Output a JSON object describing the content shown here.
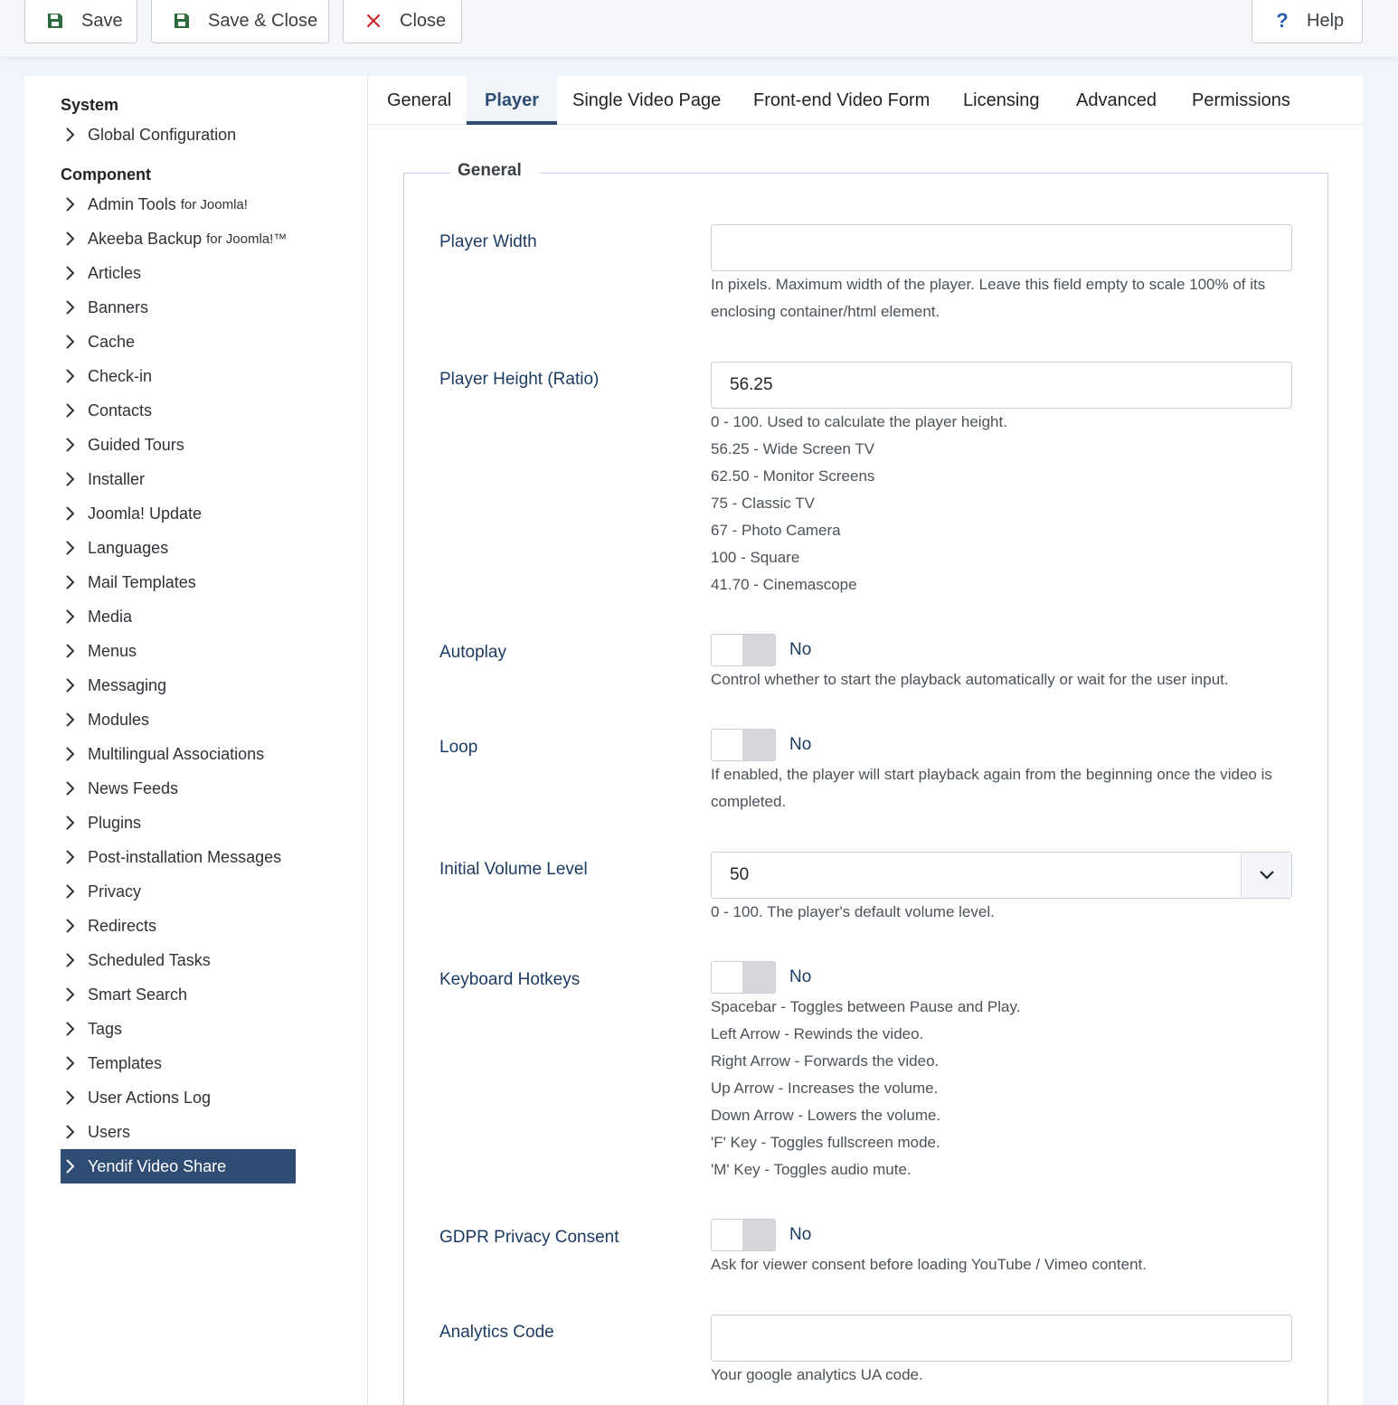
{
  "toolbar": {
    "save": "Save",
    "save_close": "Save & Close",
    "close": "Close",
    "help": "Help",
    "help_glyph": "?"
  },
  "sidebar": {
    "system_heading": "System",
    "system_items": [
      {
        "label": "Global Configuration"
      }
    ],
    "component_heading": "Component",
    "items": [
      {
        "label": "Admin Tools",
        "suffix": "for Joomla!"
      },
      {
        "label": "Akeeba Backup",
        "suffix": "for Joomla!™"
      },
      {
        "label": "Articles"
      },
      {
        "label": "Banners"
      },
      {
        "label": "Cache"
      },
      {
        "label": "Check-in"
      },
      {
        "label": "Contacts"
      },
      {
        "label": "Guided Tours"
      },
      {
        "label": "Installer"
      },
      {
        "label": "Joomla! Update"
      },
      {
        "label": "Languages"
      },
      {
        "label": "Mail Templates"
      },
      {
        "label": "Media"
      },
      {
        "label": "Menus"
      },
      {
        "label": "Messaging"
      },
      {
        "label": "Modules"
      },
      {
        "label": "Multilingual Associations"
      },
      {
        "label": "News Feeds"
      },
      {
        "label": "Plugins"
      },
      {
        "label": "Post-installation Messages"
      },
      {
        "label": "Privacy"
      },
      {
        "label": "Redirects"
      },
      {
        "label": "Scheduled Tasks"
      },
      {
        "label": "Smart Search"
      },
      {
        "label": "Tags"
      },
      {
        "label": "Templates"
      },
      {
        "label": "User Actions Log"
      },
      {
        "label": "Users"
      },
      {
        "label": "Yendif Video Share",
        "active": true
      }
    ]
  },
  "tabs": [
    {
      "label": "General"
    },
    {
      "label": "Player",
      "active": true
    },
    {
      "label": "Single Video Page"
    },
    {
      "label": "Front-end Video Form"
    },
    {
      "label": "Licensing"
    },
    {
      "label": "Advanced"
    },
    {
      "label": "Permissions"
    }
  ],
  "form": {
    "legend": "General",
    "player_width": {
      "label": "Player Width",
      "value": "",
      "help": [
        "In pixels. Maximum width of the player. Leave this field empty to scale 100% of its",
        "enclosing container/html element."
      ]
    },
    "player_height": {
      "label": "Player Height (Ratio)",
      "value": "56.25",
      "help": [
        "0 - 100. Used to calculate the player height.",
        "56.25 - Wide Screen TV",
        "62.50 - Monitor Screens",
        "75 - Classic TV",
        "67 - Photo Camera",
        "100 - Square",
        "41.70 - Cinemascope"
      ]
    },
    "autoplay": {
      "label": "Autoplay",
      "state": "No",
      "help": [
        "Control whether to start the playback automatically or wait for the user input."
      ]
    },
    "loop": {
      "label": "Loop",
      "state": "No",
      "help": [
        "If enabled, the player will start playback again from the beginning once the video is",
        "completed."
      ]
    },
    "volume": {
      "label": "Initial Volume Level",
      "value": "50",
      "help": [
        "0 - 100. The player's default volume level."
      ]
    },
    "hotkeys": {
      "label": "Keyboard Hotkeys",
      "state": "No",
      "help": [
        "Spacebar - Toggles between Pause and Play.",
        "Left Arrow - Rewinds the video.",
        "Right Arrow - Forwards the video.",
        "Up Arrow - Increases the volume.",
        "Down Arrow - Lowers the volume.",
        "'F' Key - Toggles fullscreen mode.",
        "'M' Key - Toggles audio mute."
      ]
    },
    "gdpr": {
      "label": "GDPR Privacy Consent",
      "state": "No",
      "help": [
        "Ask for viewer consent before loading YouTube / Vimeo content."
      ]
    },
    "analytics": {
      "label": "Analytics Code",
      "value": "",
      "help": [
        "Your google analytics UA code."
      ]
    }
  },
  "colors": {
    "accent": "#2f4c73",
    "label": "#1c3b63",
    "save_icon": "#2e6b3c",
    "close_icon": "#c6282b"
  }
}
